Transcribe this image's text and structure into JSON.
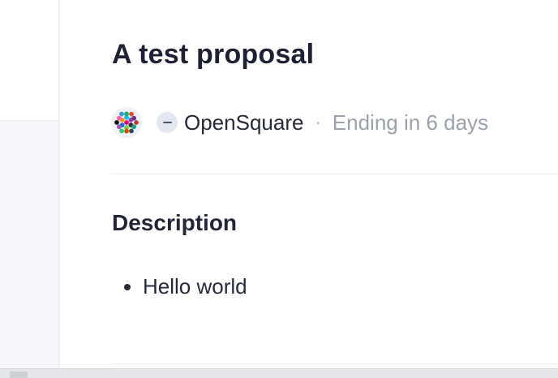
{
  "proposal": {
    "title": "A test proposal"
  },
  "meta": {
    "space_icon": "minus-icon",
    "space_name": "OpenSquare",
    "separator": "·",
    "ending_text": "Ending in 6 days"
  },
  "description": {
    "heading": "Description",
    "items": [
      "Hello world"
    ]
  },
  "colors": {
    "title": "#1e2134",
    "muted": "#9aa0ac",
    "divider": "#eceef2",
    "background": "#f6f7fa"
  }
}
